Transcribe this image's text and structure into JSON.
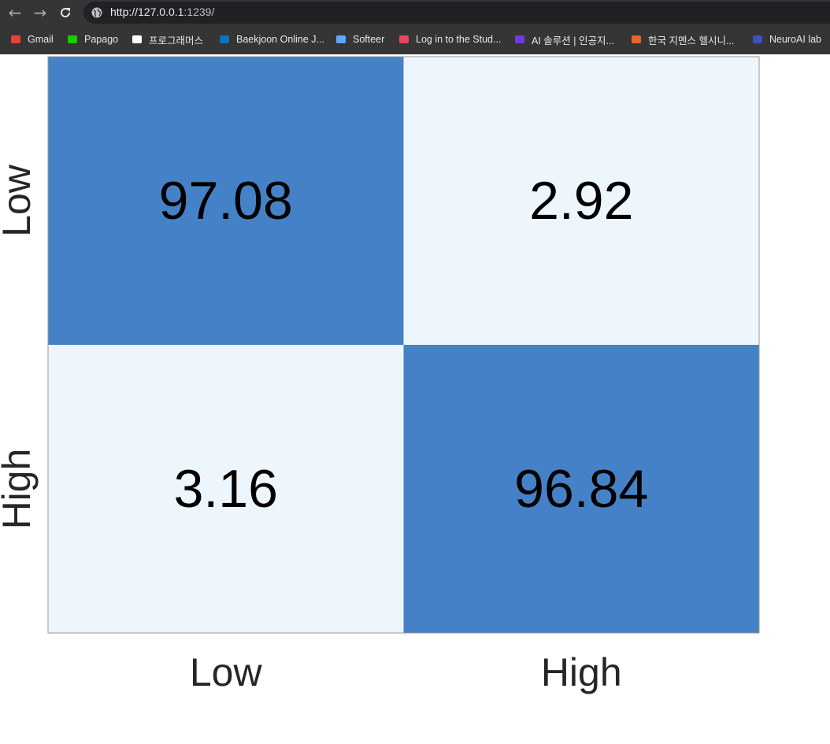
{
  "browser": {
    "url_host": "http://127.0.0.1",
    "url_rest": ":1239/",
    "back_icon": "arrow-left-icon",
    "forward_icon": "arrow-right-icon",
    "reload_icon": "reload-icon",
    "site_info_icon": "globe-icon"
  },
  "bookmarks": [
    {
      "label": "Gmail",
      "icon": "gmail-icon",
      "color": "#ea4335"
    },
    {
      "label": "Papago",
      "icon": "papago-icon",
      "color": "#1ec800"
    },
    {
      "label": "프로그래머스",
      "icon": "programmers-icon",
      "color": "#ffffff"
    },
    {
      "label": "Baekjoon Online J...",
      "icon": "code-icon",
      "color": "#0076c0"
    },
    {
      "label": "Softeer",
      "icon": "softeer-icon",
      "color": "#5aa9ff"
    },
    {
      "label": "Log in to the Stud...",
      "icon": "bookmark-icon",
      "color": "#e2485c"
    },
    {
      "label": "AI 솔루션 | 인공지...",
      "icon": "ai-solution-icon",
      "color": "#6b3fd4"
    },
    {
      "label": "한국 지멘스 헬시니...",
      "icon": "siemens-icon",
      "color": "#e3662b"
    },
    {
      "label": "NeuroAI lab",
      "icon": "neuroai-icon",
      "color": "#3f51b5"
    }
  ],
  "chart_data": {
    "type": "heatmap",
    "rows": [
      "Low",
      "High"
    ],
    "columns": [
      "Low",
      "High"
    ],
    "values": [
      [
        97.08,
        2.92
      ],
      [
        3.16,
        96.84
      ]
    ],
    "colors": {
      "high": "#4581c7",
      "low": "#eef6fd",
      "text": "#000000",
      "label": "#262626",
      "border": "#999999"
    }
  }
}
